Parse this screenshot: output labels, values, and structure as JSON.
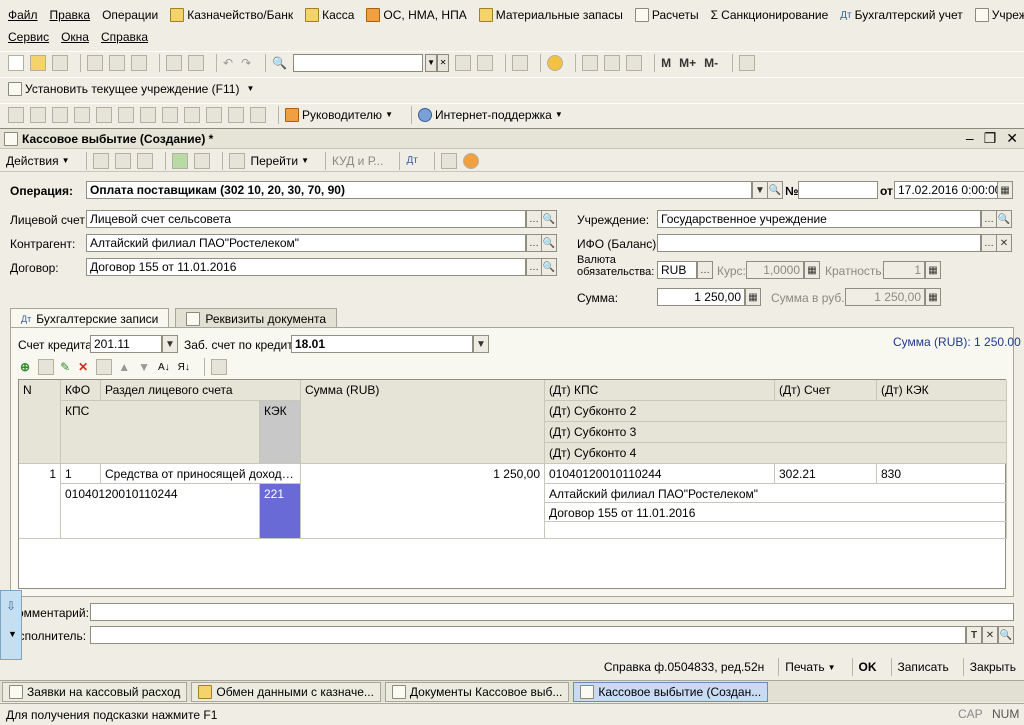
{
  "menu": {
    "row1": [
      "Файл",
      "Правка",
      "Операции",
      "Казначейство/Банк",
      "Касса",
      "ОС, НМА, НПА",
      "Материальные запасы",
      "Расчеты",
      "Санкционирование",
      "Бухгалтерский учет",
      "Учреждение"
    ],
    "row2": [
      "Сервис",
      "Окна",
      "Справка"
    ]
  },
  "toolbar": {
    "m_label": "M",
    "mplus_label": "M+",
    "mminus_label": "M-",
    "set_institution_label": "Установить текущее учреждение (F11)",
    "manager_label": "Руководителю",
    "internet_support_label": "Интернет-поддержка"
  },
  "window": {
    "title": "Кассовое выбытие (Создание) *"
  },
  "form_toolbar": {
    "actions": "Действия",
    "goto": "Перейти",
    "kud": "КУД и Р..."
  },
  "form": {
    "operation_label": "Операция:",
    "operation_value": "Оплата поставщикам (302 10, 20, 30, 70, 90)",
    "number_label": "№",
    "number_value": "",
    "date_label": "от",
    "date_value": "17.02.2016  0:00:00",
    "account_label": "Лицевой счет:",
    "account_value": "Лицевой счет сельсовета",
    "contractor_label": "Контрагент:",
    "contractor_value": "Алтайский филиал ПАО\"Ростелеком\"",
    "contract_label": "Договор:",
    "contract_value": "Договор 155 от 11.01.2016",
    "institution_label": "Учреждение:",
    "institution_value": "Государственное учреждение",
    "ifo_label": "ИФО (Баланс):",
    "ifo_value": "",
    "currency_label": "Валюта обязательства:",
    "currency_value": "RUB",
    "rate_label": "Курс:",
    "rate_value": "1,0000",
    "multiplicity_label": "Кратность:",
    "multiplicity_value": "1",
    "sum_label": "Сумма:",
    "sum_value": "1 250,00",
    "sum_rub_label": "Сумма в руб.:",
    "sum_rub_value": "1 250,00"
  },
  "tabs": {
    "accounting": "Бухгалтерские записи",
    "details": "Реквизиты документа"
  },
  "entries": {
    "credit_account_label": "Счет кредита:",
    "credit_account_value": "201.11",
    "off_balance_label": "Заб. счет по кредиту:",
    "off_balance_value": "18.01",
    "total_label": "Сумма (RUB): 1 250.00"
  },
  "grid": {
    "headers": {
      "n": "N",
      "kfo": "КФО",
      "section": "Раздел лицевого счета",
      "sum": "Сумма (RUB)",
      "dt_kps": "(Дт) КПС",
      "dt_account": "(Дт) Счет",
      "dt_kek": "(Дт) КЭК",
      "kps": "КПС",
      "kek": "КЭК",
      "sub2": "(Дт) Субконто 2",
      "sub3": "(Дт) Субконто 3",
      "sub4": "(Дт) Субконто 4"
    },
    "row": {
      "n": "1",
      "kfo": "1",
      "section": "Средства от приносящей доход дея...",
      "sum": "1 250,00",
      "dt_kps": "01040120010110244",
      "dt_account": "302.21",
      "dt_kek": "830",
      "kps": "01040120010110244",
      "kek": "221",
      "sub2": "Алтайский филиал ПАО\"Ростелеком\"",
      "sub3": "Договор 155 от 11.01.2016"
    }
  },
  "footer": {
    "comment_label": "Комментарий:",
    "executor_label": "Исполнитель:",
    "help_ref": "Справка ф.0504833, ред.52н",
    "print": "Печать",
    "ok": "OK",
    "save": "Записать",
    "close": "Закрыть"
  },
  "taskbar": [
    "Заявки на кассовый расход",
    "Обмен данными с казначе...",
    "Документы Кассовое выб...",
    "Кассовое выбытие (Создан..."
  ],
  "status": {
    "hint": "Для получения подсказки нажмите F1",
    "cap": "CAP",
    "num": "NUM"
  }
}
